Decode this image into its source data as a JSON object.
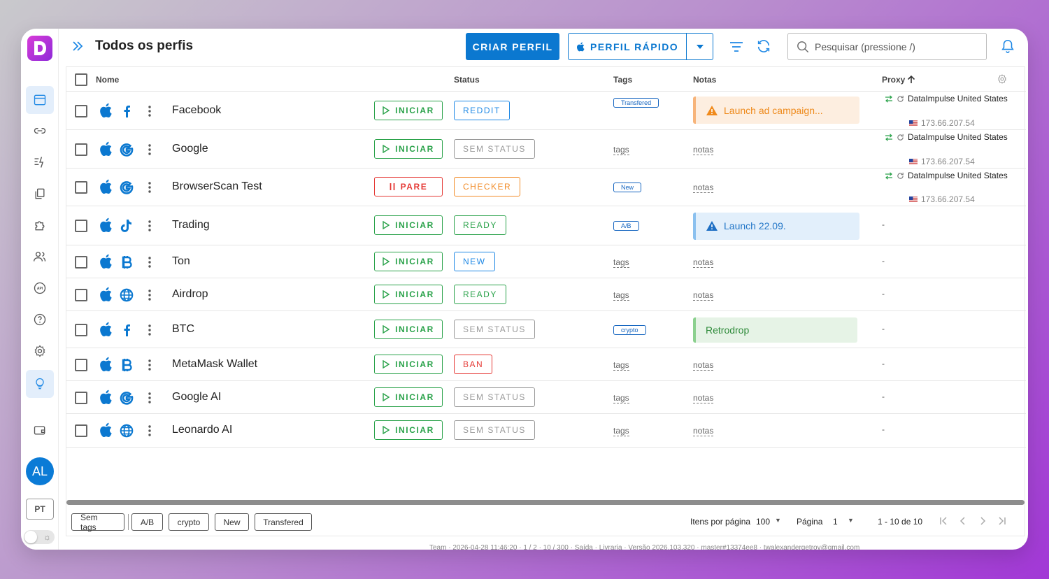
{
  "app": {
    "page_title": "Todos os perfis",
    "avatar_initials": "AL",
    "language": "PT"
  },
  "header": {
    "create_label": "CRIAR PERFIL",
    "quick_label": "PERFIL RÁPIDO",
    "search_placeholder": "Pesquisar (pressione /)"
  },
  "table": {
    "columns": {
      "name": "Nome",
      "status": "Status",
      "tags": "Tags",
      "notes": "Notas",
      "proxy": "Proxy"
    },
    "action_start": "INICIAR",
    "action_stop": "PARE",
    "tags_placeholder": "tags",
    "notes_placeholder": "notas",
    "dash": "-",
    "rows": [
      {
        "name": "Facebook",
        "site_icon": "facebook-icon",
        "action": "INICIAR",
        "status": "REDDIT",
        "status_color": "#1e88e5",
        "tag": "Transfered",
        "note": "Launch ad campaign...",
        "note_style": "orange",
        "proxy": {
          "name": "DataImpulse United States",
          "ip": "173.66.207.54"
        }
      },
      {
        "name": "Google",
        "site_icon": "google-icon",
        "action": "INICIAR",
        "status": "SEM STATUS",
        "status_color": "#999999",
        "tag": "",
        "note": "",
        "note_style": "",
        "proxy": {
          "name": "DataImpulse United States",
          "ip": "173.66.207.54"
        }
      },
      {
        "name": "BrowserScan Test",
        "site_icon": "google-icon",
        "action": "PARE",
        "status": "CHECKER",
        "status_color": "#f28c28",
        "tag": "New",
        "note": "",
        "note_style": "",
        "proxy": {
          "name": "DataImpulse United States",
          "ip": "173.66.207.54"
        }
      },
      {
        "name": "Trading",
        "site_icon": "tiktok-icon",
        "action": "INICIAR",
        "status": "READY",
        "status_color": "#2aa24a",
        "tag": "A/B",
        "note": "Launch 22.09.",
        "note_style": "blue",
        "proxy": null
      },
      {
        "name": "Ton",
        "site_icon": "bitcoin-icon",
        "action": "INICIAR",
        "status": "NEW",
        "status_color": "#1e88e5",
        "tag": "",
        "note": "",
        "note_style": "",
        "proxy": null
      },
      {
        "name": "Airdrop",
        "site_icon": "globe-icon",
        "action": "INICIAR",
        "status": "READY",
        "status_color": "#2aa24a",
        "tag": "",
        "note": "",
        "note_style": "",
        "proxy": null
      },
      {
        "name": "BTC",
        "site_icon": "facebook-icon",
        "action": "INICIAR",
        "status": "SEM STATUS",
        "status_color": "#999999",
        "tag": "crypto",
        "note": "Retrodrop",
        "note_style": "green",
        "proxy": null
      },
      {
        "name": "MetaMask Wallet",
        "site_icon": "bitcoin-icon",
        "action": "INICIAR",
        "status": "BAN",
        "status_color": "#e53935",
        "tag": "",
        "note": "",
        "note_style": "",
        "proxy": null
      },
      {
        "name": "Google AI",
        "site_icon": "google-icon",
        "action": "INICIAR",
        "status": "SEM STATUS",
        "status_color": "#999999",
        "tag": "",
        "note": "",
        "note_style": "",
        "proxy": null
      },
      {
        "name": "Leonardo AI",
        "site_icon": "globe-icon",
        "action": "INICIAR",
        "status": "SEM STATUS",
        "status_color": "#999999",
        "tag": "",
        "note": "",
        "note_style": "",
        "proxy": null
      }
    ]
  },
  "footer": {
    "tag_filters": [
      "Sem tags",
      "A/B",
      "crypto",
      "New",
      "Transfered"
    ],
    "items_per_page_label": "Itens por página",
    "items_per_page": "100",
    "page_label": "Página",
    "page": "1",
    "range": "1 - 10 de 10"
  },
  "statusbar": "Team · 2026-04-28 11:46:20 · 1 / 2 · 10 / 300 · Saída · Livraria · Versão 2026.103.320 · master#13374ee8 · twalexandergetrov@gmail.com",
  "colors": {
    "primary": "#0b78d0",
    "success": "#2aa24a",
    "danger": "#e53935",
    "warning": "#f28c28"
  }
}
